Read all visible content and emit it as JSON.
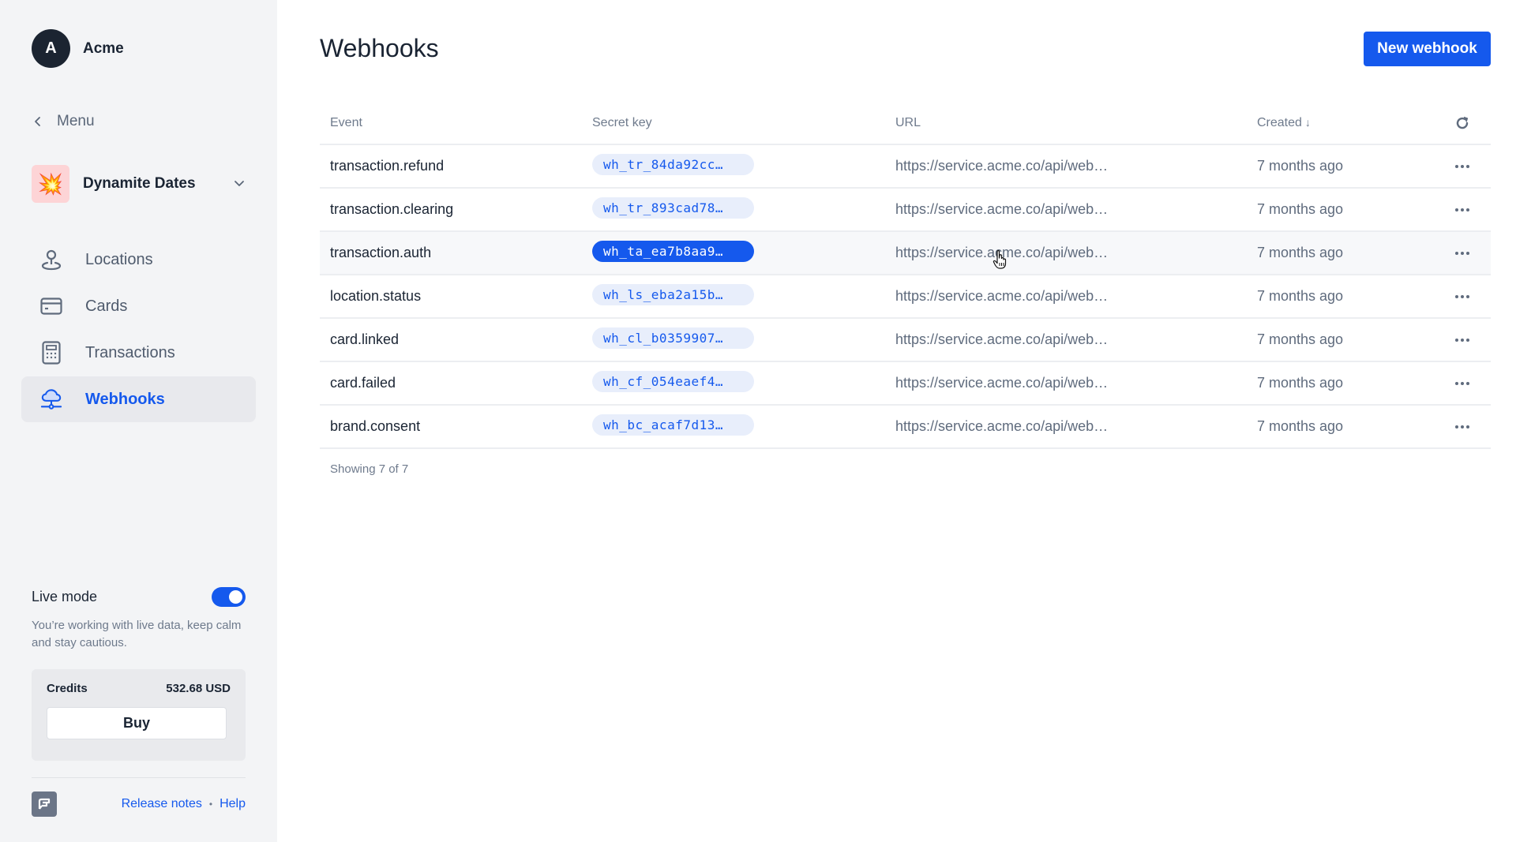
{
  "org": {
    "initial": "A",
    "name": "Acme"
  },
  "menu_back": {
    "label": "Menu",
    "icon": "chevron-left-icon"
  },
  "brand": {
    "name": "Dynamite Dates",
    "logo_emoji": "💥",
    "icon": "chevron-down-icon"
  },
  "nav": {
    "items": [
      {
        "label": "Locations",
        "icon": "location-pin-icon",
        "active": false
      },
      {
        "label": "Cards",
        "icon": "credit-card-icon",
        "active": false
      },
      {
        "label": "Transactions",
        "icon": "calculator-icon",
        "active": false
      },
      {
        "label": "Webhooks",
        "icon": "cloud-network-icon",
        "active": true
      }
    ]
  },
  "live_mode": {
    "label": "Live mode",
    "enabled": true,
    "description": "You’re working with live data, keep calm and stay cautious."
  },
  "credits": {
    "label": "Credits",
    "amount": "532.68 USD",
    "buy_label": "Buy"
  },
  "footer": {
    "release_notes": "Release notes",
    "separator": "•",
    "help": "Help"
  },
  "page": {
    "title": "Webhooks",
    "new_button": "New webhook"
  },
  "table": {
    "columns": {
      "event": "Event",
      "secret_key": "Secret key",
      "url": "URL",
      "created": "Created",
      "created_sort": "↓"
    },
    "rows": [
      {
        "event": "transaction.refund",
        "secret_key": "wh_tr_84da92cc…",
        "url": "https://service.acme.co/api/web…",
        "created": "7 months ago"
      },
      {
        "event": "transaction.clearing",
        "secret_key": "wh_tr_893cad78…",
        "url": "https://service.acme.co/api/web…",
        "created": "7 months ago"
      },
      {
        "event": "transaction.auth",
        "secret_key": "wh_ta_ea7b8aa9…",
        "url": "https://service.acme.co/api/web…",
        "created": "7 months ago",
        "hovered": true
      },
      {
        "event": "location.status",
        "secret_key": "wh_ls_eba2a15b…",
        "url": "https://service.acme.co/api/web…",
        "created": "7 months ago"
      },
      {
        "event": "card.linked",
        "secret_key": "wh_cl_b0359907…",
        "url": "https://service.acme.co/api/web…",
        "created": "7 months ago"
      },
      {
        "event": "card.failed",
        "secret_key": "wh_cf_054eaef4…",
        "url": "https://service.acme.co/api/web…",
        "created": "7 months ago"
      },
      {
        "event": "brand.consent",
        "secret_key": "wh_bc_acaf7d13…",
        "url": "https://service.acme.co/api/web…",
        "created": "7 months ago"
      }
    ],
    "showing": "Showing 7 of 7"
  },
  "colors": {
    "accent": "#1559ed",
    "sidebar_bg": "#f3f4f6",
    "pill_bg": "#e8eefb",
    "text": "#1a2433",
    "muted": "#6e7a8c"
  }
}
